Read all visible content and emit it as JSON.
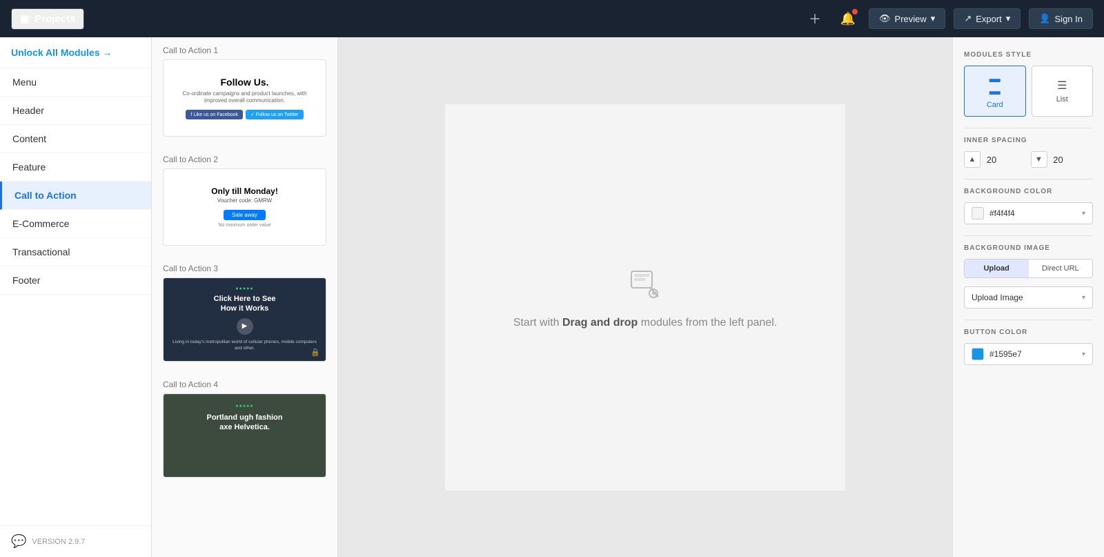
{
  "topnav": {
    "brand_label": "Projects",
    "preview_label": "Preview",
    "export_label": "Export",
    "signin_label": "Sign In",
    "preview_chevron": "▾",
    "export_chevron": "▾"
  },
  "sidebar": {
    "unlock_label": "Unlock All Modules →",
    "items": [
      {
        "label": "Menu",
        "active": false
      },
      {
        "label": "Header",
        "active": false
      },
      {
        "label": "Content",
        "active": false
      },
      {
        "label": "Feature",
        "active": false
      },
      {
        "label": "Call to Action",
        "active": true
      },
      {
        "label": "E-Commerce",
        "active": false
      },
      {
        "label": "Transactional",
        "active": false
      },
      {
        "label": "Footer",
        "active": false
      }
    ],
    "version_label": "VERSION 2.9.7"
  },
  "module_panel": {
    "cta1": {
      "section_label": "Call to Action 1",
      "title": "Follow Us.",
      "subtitle": "Co-ordinate campaigns and product launches, with improved overall communication.",
      "btn_fb": "f Like us on Facebook",
      "btn_tw": "✓ Follow us on Twitter"
    },
    "cta2": {
      "section_label": "Call to Action 2",
      "title": "Only till Monday!",
      "code_label": "Voucher code: GMRW",
      "sale_btn": "Sale away",
      "note": "No minimum order value"
    },
    "cta3": {
      "section_label": "Call to Action 3",
      "category": "●●●●●",
      "heading": "Click Here to See\nHow it Works",
      "sub": "Living in today's metropolitan world of cellular phones, mobile computers and other."
    },
    "cta4": {
      "section_label": "Call to Action 4",
      "category": "●●●●●",
      "heading": "Portland ugh fashion\naxe Helvetica."
    }
  },
  "canvas": {
    "hint_bold": "Drag and drop",
    "hint_text": "modules from the left panel."
  },
  "right_panel": {
    "modules_style_label": "MODULES STYLE",
    "card_label": "Card",
    "list_label": "List",
    "inner_spacing_label": "INNER SPACING",
    "spacing_up": 20,
    "spacing_down": 20,
    "bg_color_label": "BACKGROUND COLOR",
    "bg_color_value": "#f4f4f4",
    "bg_image_label": "BACKGROUND IMAGE",
    "upload_tab": "Upload",
    "direct_url_tab": "Direct URL",
    "upload_image_label": "Upload Image",
    "button_color_label": "BUTTON COLOR",
    "button_color_value": "#1595e7"
  }
}
